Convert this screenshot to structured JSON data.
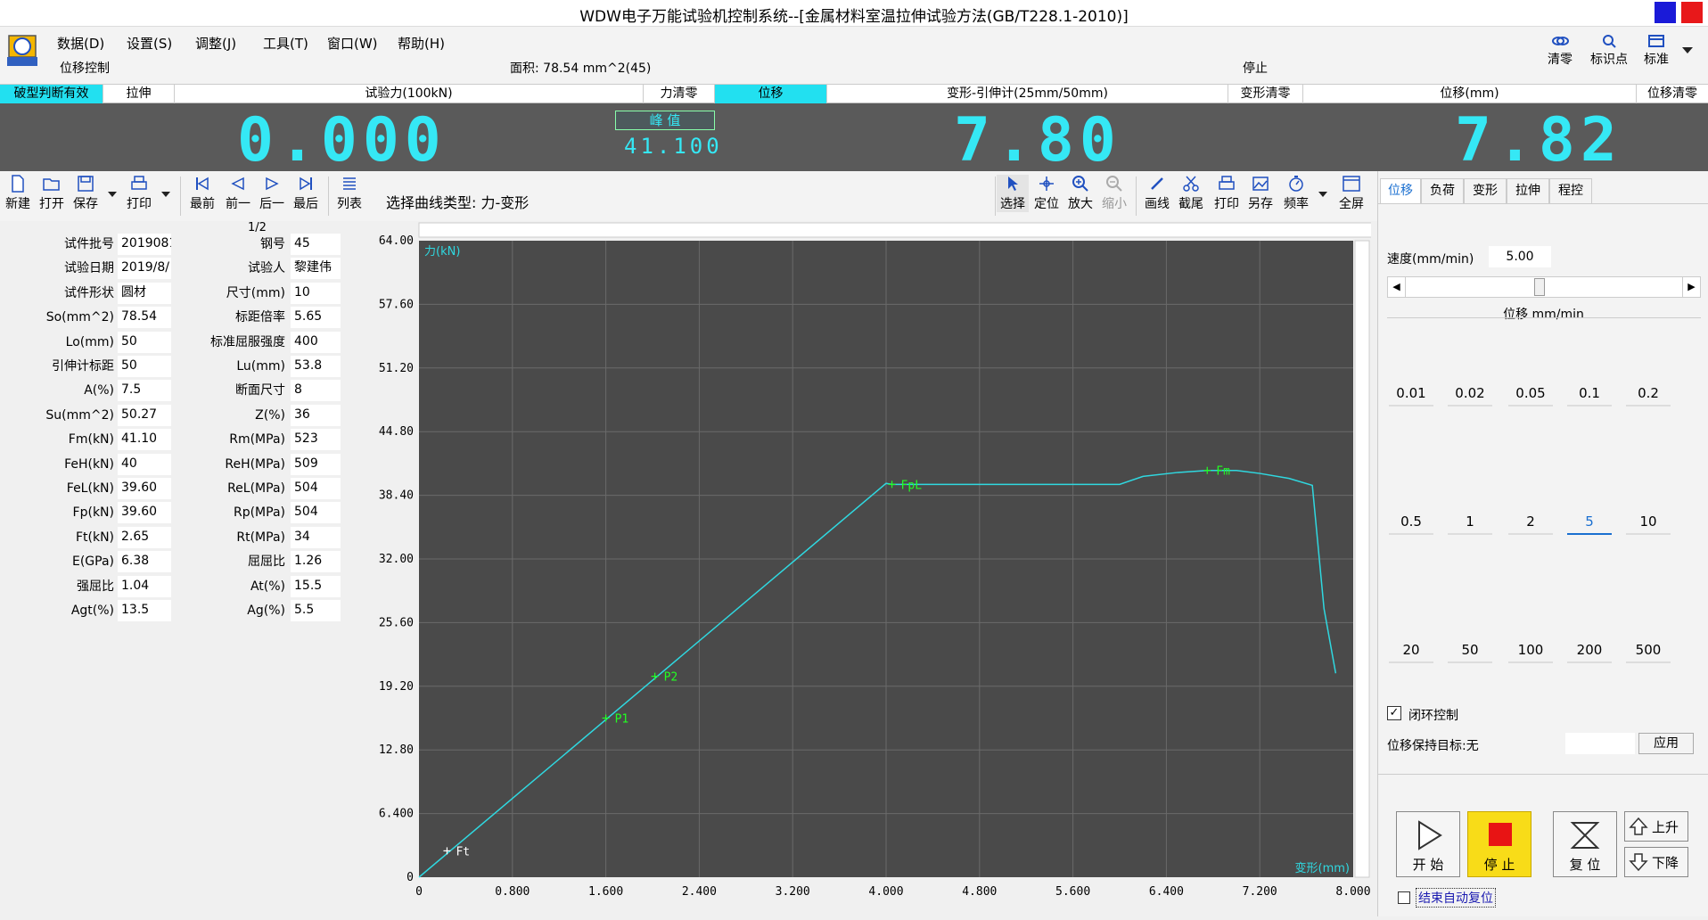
{
  "title": "WDW电子万能试验机控制系统--[金属材料室温拉伸试验方法(GB/T228.1-2010)]",
  "menu": [
    "数据(D)",
    "设置(S)",
    "调整(J)",
    "工具(T)",
    "窗口(W)",
    "帮助(H)"
  ],
  "mode": "位移控制",
  "area": "面积: 78.54 mm^2(45)",
  "status": "停止",
  "top_tools": [
    {
      "label": "清零",
      "icon": "clear-icon"
    },
    {
      "label": "标识点",
      "icon": "marker-icon"
    },
    {
      "label": "标准",
      "icon": "standard-icon"
    }
  ],
  "header": {
    "break_valid": "破型判断有效",
    "tension": "拉伸",
    "force_title": "试验力(100kN)",
    "force_zero": "力清零",
    "displacement_tab": "位移",
    "deform_title": "变形-引伸计(25mm/50mm)",
    "deform_zero": "变形清零",
    "disp_title": "位移(mm)",
    "disp_zero": "位移清零"
  },
  "display": {
    "force_value": "0.000",
    "peak_label": "峰  值",
    "peak_value": "41.100",
    "deform_value": "7.80",
    "disp_value": "7.82"
  },
  "toolbar": {
    "file_buttons": [
      "新建",
      "打开",
      "保存",
      "打印"
    ],
    "nav_buttons": [
      "最前",
      "前一",
      "后一",
      "最后"
    ],
    "list_button": "列表",
    "curve_type": "选择曲线类型:  力-变形",
    "chart_tools": [
      "选择",
      "定位",
      "放大",
      "缩小",
      "画线",
      "截尾",
      "打印",
      "另存",
      "频率",
      "全屏"
    ]
  },
  "page_indicator": "1/2",
  "params_left": [
    {
      "label": "试件批号",
      "value": "2019081"
    },
    {
      "label": "试验日期",
      "value": "2019/8/"
    },
    {
      "label": "试件形状",
      "value": "圆材"
    },
    {
      "label": "So(mm^2)",
      "value": "78.54"
    },
    {
      "label": "Lo(mm)",
      "value": "50"
    },
    {
      "label": "引伸计标距",
      "value": "50"
    },
    {
      "label": "A(%)",
      "value": "7.5"
    },
    {
      "label": "Su(mm^2)",
      "value": "50.27"
    },
    {
      "label": "Fm(kN)",
      "value": "41.10"
    },
    {
      "label": "FeH(kN)",
      "value": "40"
    },
    {
      "label": "FeL(kN)",
      "value": "39.60"
    },
    {
      "label": "Fp(kN)",
      "value": "39.60"
    },
    {
      "label": "Ft(kN)",
      "value": "2.65"
    },
    {
      "label": "E(GPa)",
      "value": "6.38"
    },
    {
      "label": "强屈比",
      "value": "1.04"
    },
    {
      "label": "Agt(%)",
      "value": "13.5"
    }
  ],
  "params_right": [
    {
      "label": "钢号",
      "value": "45"
    },
    {
      "label": "试验人",
      "value": "黎建伟"
    },
    {
      "label": "尺寸(mm)",
      "value": "10"
    },
    {
      "label": "标距倍率",
      "value": "5.65"
    },
    {
      "label": "标准屈服强度",
      "value": "400"
    },
    {
      "label": "Lu(mm)",
      "value": "53.8"
    },
    {
      "label": "断面尺寸",
      "value": "8"
    },
    {
      "label": "Z(%)",
      "value": "36"
    },
    {
      "label": "Rm(MPa)",
      "value": "523"
    },
    {
      "label": "ReH(MPa)",
      "value": "509"
    },
    {
      "label": "ReL(MPa)",
      "value": "504"
    },
    {
      "label": "Rp(MPa)",
      "value": "504"
    },
    {
      "label": "Rt(MPa)",
      "value": "34"
    },
    {
      "label": "屈屈比",
      "value": "1.26"
    },
    {
      "label": "At(%)",
      "value": "15.5"
    },
    {
      "label": "Ag(%)",
      "value": "5.5"
    }
  ],
  "chart_data": {
    "type": "line",
    "ylabel": "力(kN)",
    "xlabel": "变形(mm)",
    "xlim": [
      0,
      8.0
    ],
    "ylim": [
      0,
      64.0
    ],
    "x_ticks": [
      "0",
      "0.800",
      "1.600",
      "2.400",
      "3.200",
      "4.000",
      "4.800",
      "5.600",
      "6.400",
      "7.200",
      "8.000"
    ],
    "y_ticks": [
      "0",
      "6.400",
      "12.80",
      "19.20",
      "25.60",
      "32.00",
      "38.40",
      "44.80",
      "51.20",
      "57.60",
      "64.00"
    ],
    "background": "#4a4a4a",
    "grid_color": "#6a6a6a",
    "line_color": "#2fd8e0",
    "series": [
      {
        "x": [
          0,
          4.0,
          4.05,
          6.0,
          6.2,
          6.5,
          6.75,
          7.0,
          7.2,
          7.45,
          7.65,
          7.75,
          7.85
        ],
        "y": [
          0,
          39.6,
          39.5,
          39.5,
          40.3,
          40.7,
          40.9,
          40.9,
          40.6,
          40.1,
          39.4,
          27.0,
          20.5
        ]
      }
    ],
    "markers": [
      {
        "label": "Ft",
        "x": 0.24,
        "y": 2.65,
        "color": "#ffffff"
      },
      {
        "label": "P1",
        "x": 1.6,
        "y": 16.0,
        "color": "#22ff22"
      },
      {
        "label": "P2",
        "x": 2.02,
        "y": 20.2,
        "color": "#22ff22"
      },
      {
        "label": "FpL",
        "x": 4.05,
        "y": 39.5,
        "color": "#22ff22"
      },
      {
        "label": "Fm",
        "x": 6.75,
        "y": 40.9,
        "color": "#22ff22"
      }
    ]
  },
  "right_panel": {
    "tabs": [
      "位移",
      "负荷",
      "变形",
      "拉伸",
      "程控"
    ],
    "speed_label": "速度(mm/min)",
    "speed_value": "5.00",
    "unit_label": "位移 mm/min",
    "speeds": [
      "0.01",
      "0.02",
      "0.05",
      "0.1",
      "0.2",
      "0.5",
      "1",
      "2",
      "5",
      "10",
      "20",
      "50",
      "100",
      "200",
      "500"
    ],
    "selected_speed": "5",
    "closed_loop": "闭环控制",
    "hold_target": "位移保持目标:无",
    "apply": "应用",
    "start": "开 始",
    "stop": "停 止",
    "reset": "复 位",
    "up": "上升",
    "down": "下降",
    "auto_reset": "结束自动复位"
  }
}
